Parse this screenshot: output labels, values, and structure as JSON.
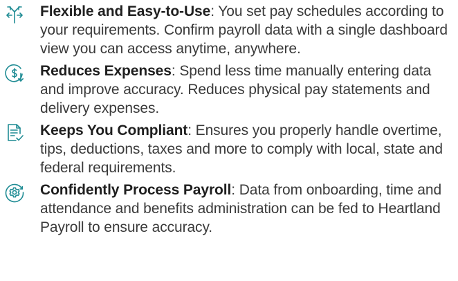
{
  "features": [
    {
      "icon": "diverging-arrows-icon",
      "title": "Flexible and Easy-to-Use",
      "separator": ": ",
      "description": "You set pay schedules according to your requirements. Confirm payroll data with a single dashboard view you can access anytime, anywhere."
    },
    {
      "icon": "dollar-savings-icon",
      "title": "Reduces Expenses",
      "separator": ": ",
      "description": "Spend less time manually entering data and improve accuracy. Reduces physical pay statements and delivery expenses."
    },
    {
      "icon": "document-check-icon",
      "title": "Keeps You Compliant",
      "separator": ":  ",
      "description": "Ensures you properly handle overtime, tips, deductions, taxes and more to comply with local, state and federal requirements."
    },
    {
      "icon": "gear-process-icon",
      "title": "Confidently Process Payroll",
      "separator": ": ",
      "description": "Data from onboarding, time and attendance and benefits administration can be fed to Heartland Payroll to ensure accuracy."
    }
  ],
  "colors": {
    "icon": "#1f8c94",
    "title": "#1f1f1f",
    "body": "#3a3a3a"
  }
}
